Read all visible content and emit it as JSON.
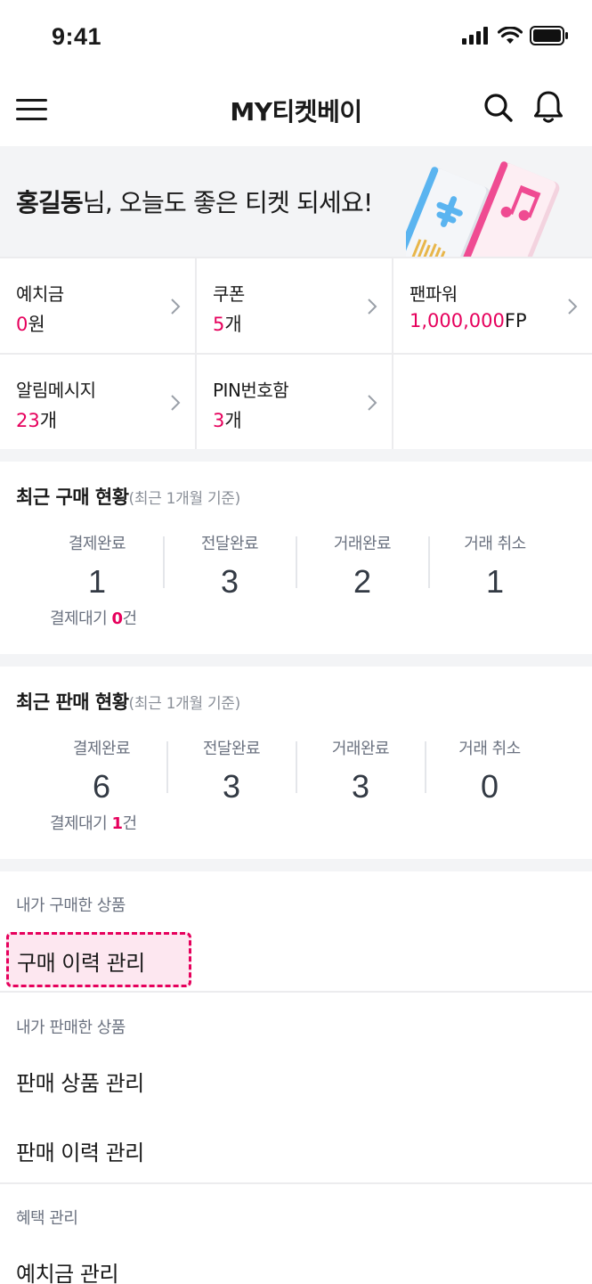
{
  "status_bar": {
    "time": "9:41"
  },
  "header": {
    "title": "MY티켓베이"
  },
  "banner": {
    "name": "홍길동",
    "greeting_rest": "님, 오늘도 좋은 티켓 되세요!"
  },
  "summary": [
    {
      "label": "예치금",
      "num": "0",
      "unit": "원"
    },
    {
      "label": "쿠폰",
      "num": "5",
      "unit": "개"
    },
    {
      "label": "팬파워",
      "num": "1,000,000",
      "unit": "FP"
    },
    {
      "label": "알림메시지",
      "num": "23",
      "unit": "개"
    },
    {
      "label": "PIN번호함",
      "num": "3",
      "unit": "개"
    }
  ],
  "purchase_status": {
    "title": "최근 구매 현황",
    "subtitle": "(최근 1개월 기준)",
    "stats": [
      {
        "label": "결제완료",
        "value": "1"
      },
      {
        "label": "전달완료",
        "value": "3"
      },
      {
        "label": "거래완료",
        "value": "2"
      },
      {
        "label": "거래 취소",
        "value": "1"
      }
    ],
    "pending_label": "결제대기 ",
    "pending_num": "0",
    "pending_unit": "건"
  },
  "sales_status": {
    "title": "최근 판매 현황",
    "subtitle": "(최근 1개월 기준)",
    "stats": [
      {
        "label": "결제완료",
        "value": "6"
      },
      {
        "label": "전달완료",
        "value": "3"
      },
      {
        "label": "거래완료",
        "value": "3"
      },
      {
        "label": "거래 취소",
        "value": "0"
      }
    ],
    "pending_label": "결제대기 ",
    "pending_num": "1",
    "pending_unit": "건"
  },
  "menu": {
    "purchased_label": "내가 구매한 상품",
    "purchase_history": "구매 이력 관리",
    "sold_label": "내가 판매한 상품",
    "sales_products": "판매 상품 관리",
    "sales_history": "판매 이력 관리",
    "benefits_label": "혜택 관리",
    "deposit_manage": "예치금 관리"
  },
  "colors": {
    "accent": "#e6005c",
    "highlight_bg": "#fde7f0",
    "banner_bg": "#f3f4f6"
  }
}
